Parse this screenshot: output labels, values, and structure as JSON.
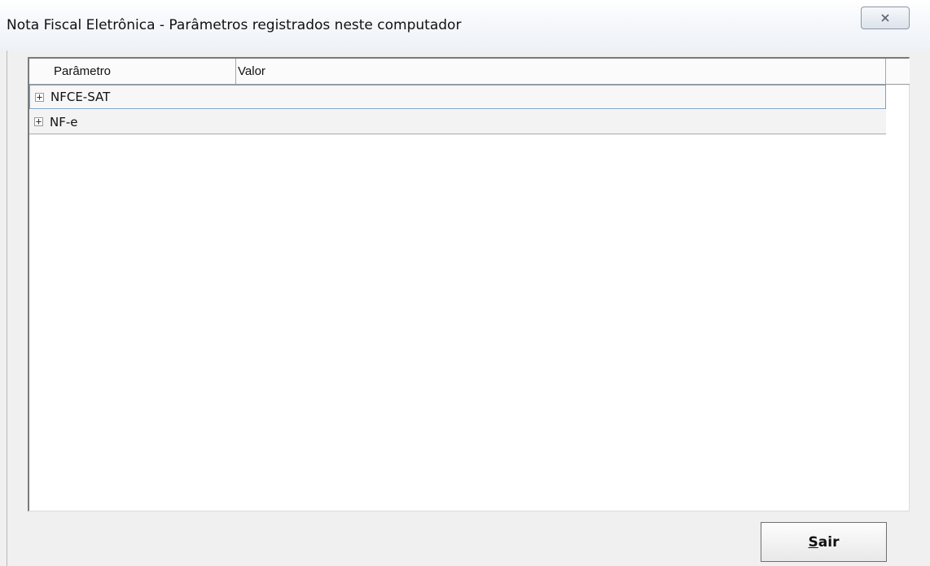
{
  "window": {
    "title": "Nota Fiscal Eletrônica - Parâmetros registrados neste computador",
    "close_icon": "close-icon"
  },
  "grid": {
    "columns": [
      "Parâmetro",
      "Valor"
    ],
    "rows": [
      {
        "expander": "+",
        "label": "NFCE-SAT",
        "selected": true
      },
      {
        "expander": "+",
        "label": "NF-e",
        "selected": false
      }
    ]
  },
  "footer": {
    "exit_button": {
      "mnemonic": "S",
      "rest": "air"
    }
  }
}
